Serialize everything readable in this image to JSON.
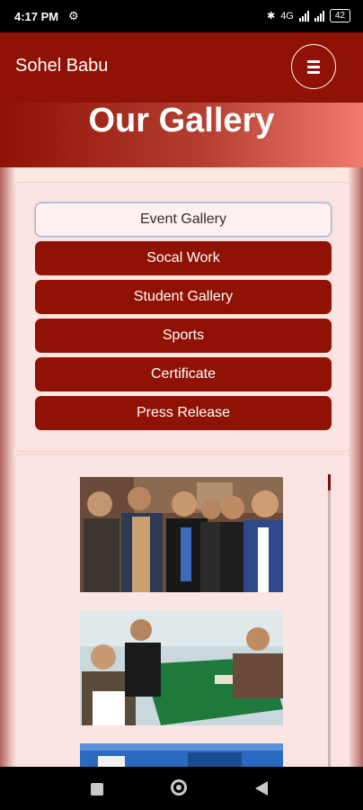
{
  "status_bar": {
    "time": "4:17 PM",
    "battery": "42",
    "network_label": "4G"
  },
  "header": {
    "brand": "Sohel Babu",
    "menu_icon": "hamburger-icon"
  },
  "hero": {
    "title": "Our Gallery"
  },
  "tabs": [
    {
      "label": "Event Gallery",
      "active": true
    },
    {
      "label": "Socal Work",
      "active": false
    },
    {
      "label": "Student Gallery",
      "active": false
    },
    {
      "label": "Sports",
      "active": false
    },
    {
      "label": "Certificate",
      "active": false
    },
    {
      "label": "Press Release",
      "active": false
    }
  ],
  "colors": {
    "brand": "#8f1204",
    "page_bg": "#fbe6e2",
    "active_tab_bg": "#fff1ef"
  }
}
